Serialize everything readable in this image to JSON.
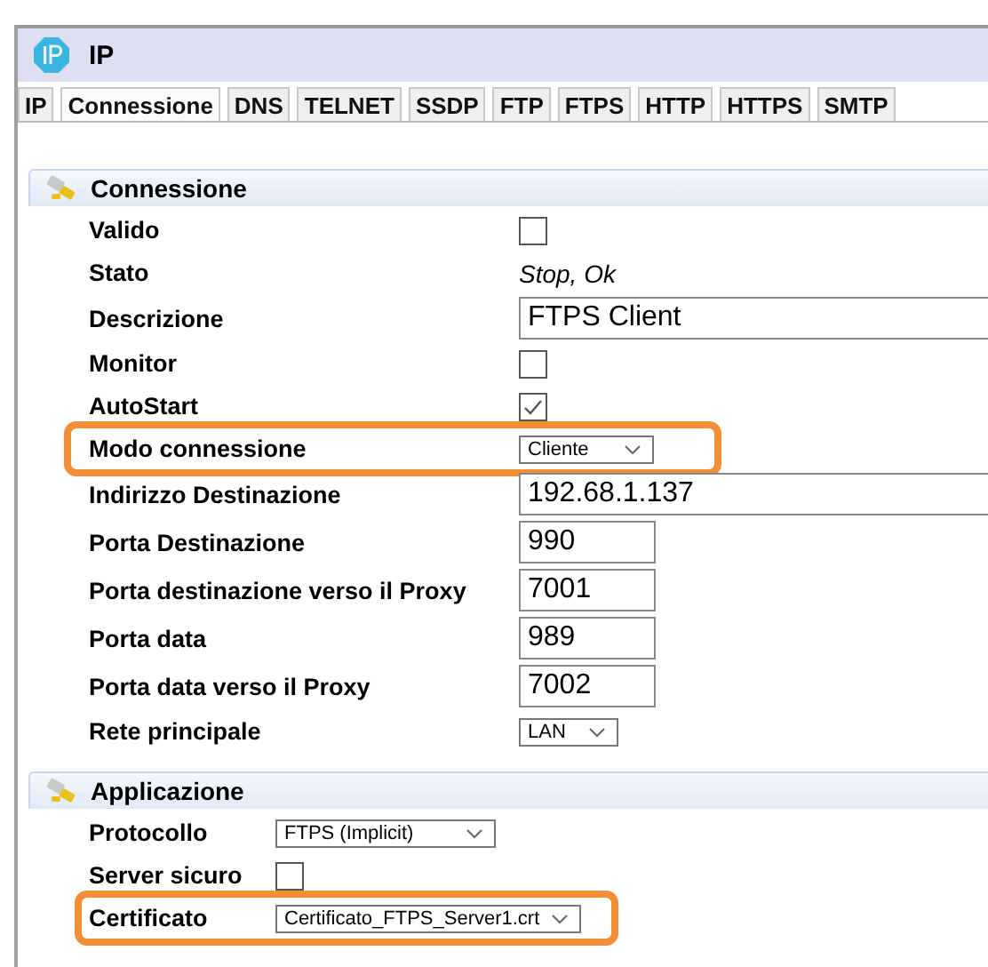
{
  "window": {
    "title": "IP"
  },
  "tabs": [
    {
      "label": "IP",
      "selected": false
    },
    {
      "label": "Connessione",
      "selected": true
    },
    {
      "label": "DNS",
      "selected": false
    },
    {
      "label": "TELNET",
      "selected": false
    },
    {
      "label": "SSDP",
      "selected": false
    },
    {
      "label": "FTP",
      "selected": false
    },
    {
      "label": "FTPS",
      "selected": false
    },
    {
      "label": "HTTP",
      "selected": false
    },
    {
      "label": "HTTPS",
      "selected": false
    },
    {
      "label": "SMTP",
      "selected": false
    }
  ],
  "sections": [
    {
      "title": "Connessione",
      "rows": [
        {
          "label": "Valido",
          "kind": "checkbox",
          "checked": false,
          "highlighted": false
        },
        {
          "label": "Stato",
          "kind": "status",
          "value": "Stop, Ok",
          "highlighted": false
        },
        {
          "label": "Descrizione",
          "kind": "field",
          "value": "FTPS Client",
          "highlighted": false
        },
        {
          "label": "Monitor",
          "kind": "checkbox",
          "checked": false,
          "highlighted": false
        },
        {
          "label": "AutoStart",
          "kind": "checkbox",
          "checked": true,
          "highlighted": false
        },
        {
          "label": "Modo connessione",
          "kind": "dropdown",
          "value": "Cliente",
          "highlighted": true
        },
        {
          "label": "Indirizzo Destinazione",
          "kind": "field",
          "value": "192.68.1.137",
          "highlighted": false
        },
        {
          "label": "Porta Destinazione",
          "kind": "port",
          "value": "990",
          "highlighted": false
        },
        {
          "label": "Porta destinazione verso il Proxy",
          "kind": "port",
          "value": "7001",
          "highlighted": false
        },
        {
          "label": "Porta data",
          "kind": "port",
          "value": "989",
          "highlighted": false
        },
        {
          "label": "Porta data verso il Proxy",
          "kind": "port",
          "value": "7002",
          "highlighted": false
        },
        {
          "label": "Rete principale",
          "kind": "dropdown",
          "value": "LAN",
          "highlighted": false
        }
      ]
    },
    {
      "title": "Applicazione",
      "rows": [
        {
          "label": "Protocollo",
          "kind": "dropdown",
          "value": "FTPS (Implicit)",
          "highlighted": false
        },
        {
          "label": "Server sicuro",
          "kind": "checkbox",
          "checked": false,
          "highlighted": false
        },
        {
          "label": "Certificato",
          "kind": "dropdown",
          "value": "Certificato_FTPS_Server1.crt",
          "highlighted": true
        }
      ]
    }
  ]
}
